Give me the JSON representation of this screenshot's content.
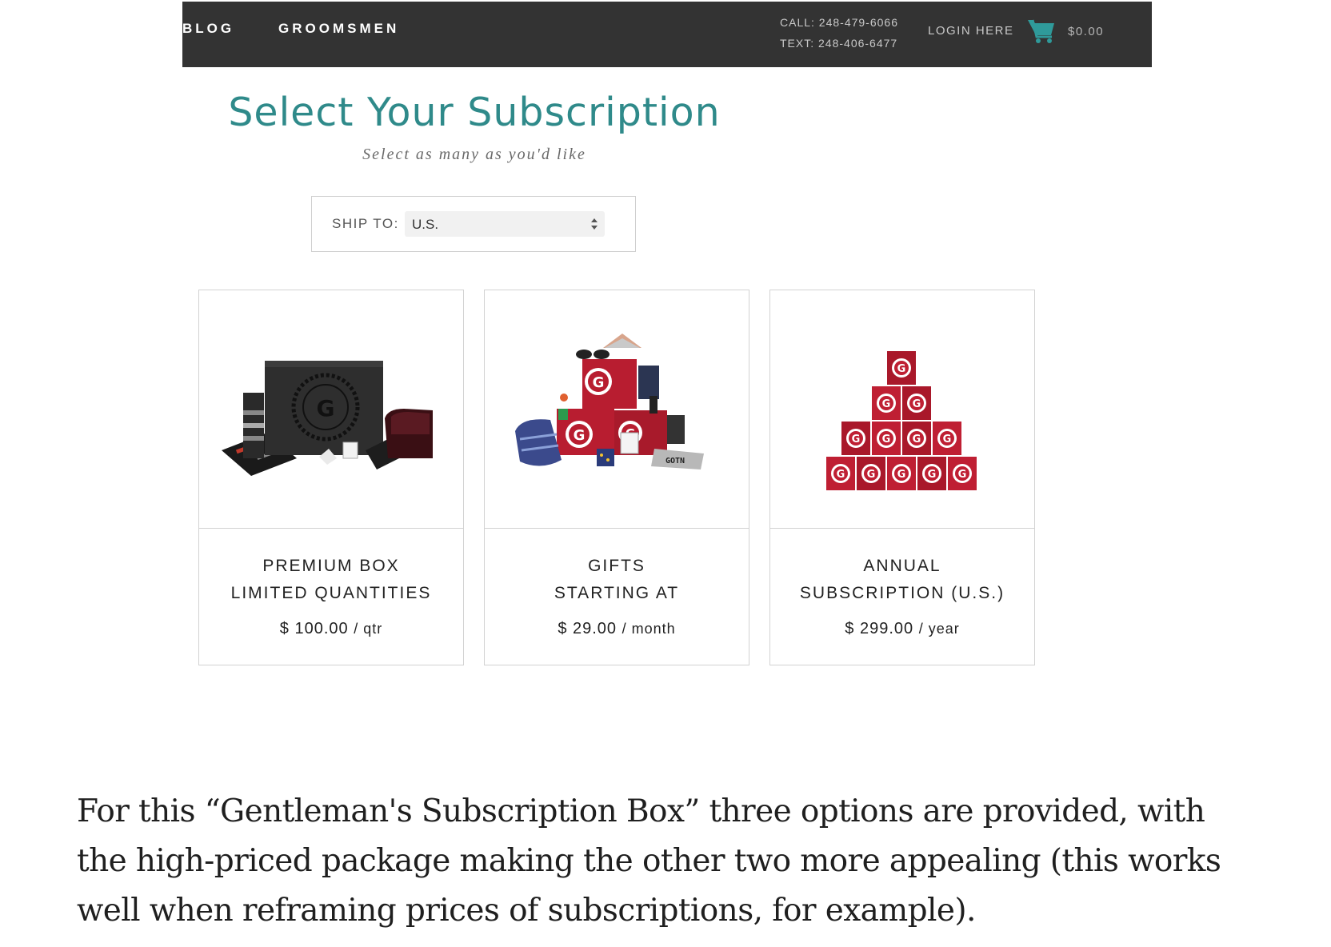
{
  "nav": {
    "links": [
      "BLOG",
      "GROOMSMEN"
    ],
    "call": "CALL: 248-479-6066",
    "text": "TEXT: 248-406-6477",
    "login": "LOGIN HERE",
    "cart_total": "$0.00",
    "cart_icon": "shopping-cart-icon",
    "bar_color": "#333333",
    "accent_color": "#2f8a8a"
  },
  "heading": {
    "title": "Select Your Subscription",
    "subtitle": "Select as many as you'd like"
  },
  "ship_to": {
    "label": "SHIP TO:",
    "value": "U.S."
  },
  "products": [
    {
      "line1": "PREMIUM BOX",
      "line2": "LIMITED QUANTITIES",
      "price": "$ 100.00",
      "period": "/ qtr",
      "image": "premium-box-image"
    },
    {
      "line1": "GIFTS",
      "line2": "STARTING AT",
      "price": "$ 29.00",
      "period": "/ month",
      "image": "gifts-bundle-image"
    },
    {
      "line1": "ANNUAL",
      "line2": "SUBSCRIPTION (U.S.)",
      "price": "$ 299.00",
      "period": "/ year",
      "image": "annual-boxes-pyramid-image"
    }
  ],
  "article": {
    "paragraph": "For this “Gentleman's Subscription Box” three options are provided, with the high-priced package making the other two more appealing (this works well when reframing prices of subscriptions, for example)."
  }
}
